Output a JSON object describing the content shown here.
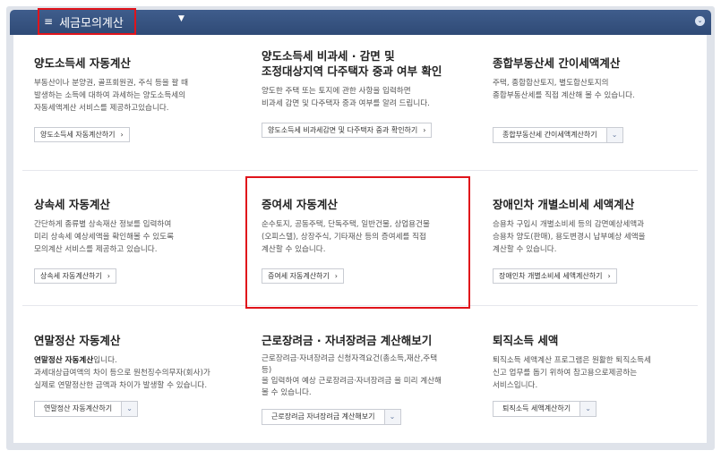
{
  "header": {
    "menu_icon": "≡",
    "menu_title": "세금모의계산",
    "dropdown_icon": "▼",
    "collapse_icon": "⌄"
  },
  "cards": [
    {
      "title": "양도소득세 자동계산",
      "desc": [
        "부동산이나 분양권, 골프회원권, 주식 등을 팔 때",
        "발생하는 소득에 대하여 과세하는 양도소득세의",
        "자동세액계산 서비스를 제공하고있습니다."
      ],
      "button": "양도소득세 자동계산하기"
    },
    {
      "title_lines": [
        "양도소득세 비과세 · 감면 및",
        "조정대상지역 다주택자 중과 여부 확인"
      ],
      "desc": [
        "양도한 주택 또는 토지에 관한 사항을 입력하면",
        "비과세 감면 및 다주택자 중과 여부를 알려 드립니다."
      ],
      "button": "양도소득세 비과세감면 및 다주택자 중과 확인하기"
    },
    {
      "title": "종합부동산세 간이세액계산",
      "desc": [
        "주택, 종합합산토지, 별도합산토지의",
        "종합부동산세를 직접 계산해 볼 수 있습니다."
      ],
      "button": "종합부동산세 간이세액계산하기"
    },
    {
      "title": "상속세 자동계산",
      "desc": [
        "간단하게 종류별 상속재산 정보를 입력하여",
        "미리 상속세 예상세액을 확인해볼 수 있도록",
        "모의계산 서비스를 제공하고 있습니다."
      ],
      "button": "상속세 자동계산하기"
    },
    {
      "title": "증여세 자동계산",
      "desc": [
        "순수토지, 공동주택, 단독주택, 일반건물, 상업용건물",
        "(오피스텔), 상장주식, 기타재산 등의 증여세를 직접",
        "계산할 수 있습니다."
      ],
      "button": "증여세 자동계산하기"
    },
    {
      "title": "장애인차 개별소비세 세액계산",
      "desc": [
        "승용차 구입시 개별소비세 등의 감면예상세액과",
        "승용차 양도(판매), 용도변경시 납부예상 세액을",
        "계산할 수 있습니다."
      ],
      "button": "장애인차 개별소비세 세액계산하기"
    },
    {
      "title": "연말정산 자동계산",
      "desc_bold": "연말정산 자동계산",
      "desc_first_rest": "입니다.",
      "desc": [
        "과세대상급여액의 차이 등으로 원천징수의무자(회사)가",
        "실제로 연말정산한 금액과 차이가 발생할 수 있습니다."
      ],
      "button": "연말정산 자동계산하기"
    },
    {
      "title": "근로장려금 · 자녀장려금 계산해보기",
      "desc": [
        "근로장려금·자녀장려금 신청자격요건(총소득,재산,주택",
        "등)",
        "을 입력하여 예상 근로장려금·자녀장려금 을 미리 계산해",
        "볼 수 있습니다."
      ],
      "button": "근로장려금 자녀장려금 계산해보기"
    },
    {
      "title": "퇴직소득 세액",
      "desc": [
        "퇴직소득 세액계산 프로그램은 원활한 퇴직소득세",
        "신고 업무를 돕기 위하여 참고용으로제공하는",
        "서비스입니다."
      ],
      "button": "퇴직소득 세액계산하기"
    }
  ],
  "icons": {
    "arrow": "›",
    "chevron": "⌄"
  }
}
